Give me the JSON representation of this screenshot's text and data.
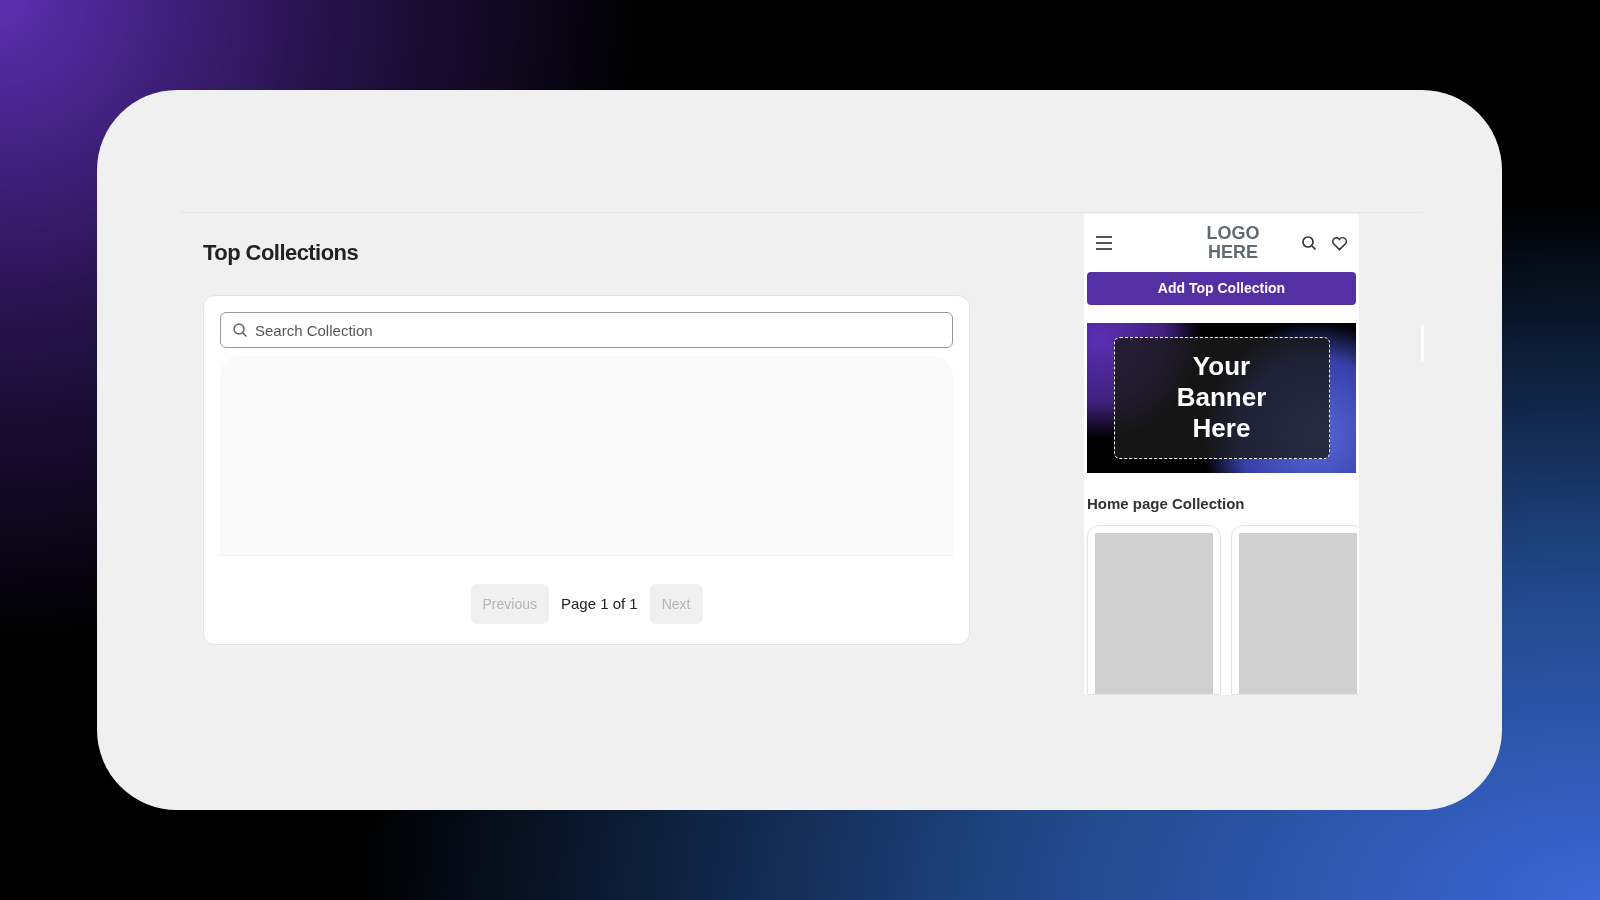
{
  "page": {
    "title": "Top Collections"
  },
  "search": {
    "placeholder": "Search Collection"
  },
  "pagination": {
    "previous": {
      "label": "Previous",
      "disabled": true
    },
    "info": "Page 1 of 1",
    "next": {
      "label": "Next",
      "disabled": true
    }
  },
  "preview": {
    "logo_lines": [
      "LOGO",
      "HERE"
    ],
    "add_button": "Add Top Collection",
    "banner_lines": [
      "Your",
      "Banner",
      "Here"
    ],
    "section_title": "Home page Collection",
    "cards": [
      {
        "kind": "product"
      },
      {
        "kind": "product"
      }
    ]
  }
}
